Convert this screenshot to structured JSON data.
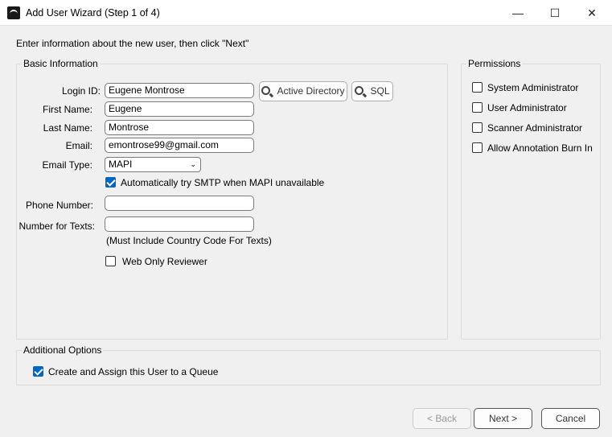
{
  "window": {
    "title": "Add User Wizard (Step 1 of 4)",
    "minimize": "—",
    "maximize": "☐",
    "close": "✕"
  },
  "instructions": "Enter information about the new user, then click \"Next\"",
  "basic": {
    "title": "Basic Information",
    "login_label": "Login ID:",
    "login_value": "Eugene Montrose",
    "ad_button": "Active Directory",
    "sql_button": "SQL",
    "first_label": "First Name:",
    "first_value": "Eugene",
    "last_label": "Last Name:",
    "last_value": "Montrose",
    "email_label": "Email:",
    "email_value": "emontrose99@gmail.com",
    "email_type_label": "Email Type:",
    "email_type_value": "MAPI",
    "smtp_label": "Automatically try SMTP when MAPI unavailable",
    "smtp_checked": true,
    "phone_label": "Phone Number:",
    "phone_value": "",
    "texts_label": "Number for Texts:",
    "texts_value": "",
    "texts_hint": "(Must Include Country Code For Texts)",
    "web_only_label": "Web Only Reviewer",
    "web_only_checked": false
  },
  "permissions": {
    "title": "Permissions",
    "items": [
      {
        "label": "System Administrator",
        "checked": false
      },
      {
        "label": "User Administrator",
        "checked": false
      },
      {
        "label": "Scanner Administrator",
        "checked": false
      },
      {
        "label": "Allow Annotation Burn In",
        "checked": false
      }
    ]
  },
  "additional": {
    "title": "Additional Options",
    "queue_label": "Create and Assign this User to a Queue",
    "queue_checked": true
  },
  "buttons": {
    "back": "< Back",
    "next": "Next >",
    "cancel": "Cancel"
  },
  "colors": {
    "accent": "#0067c0"
  }
}
